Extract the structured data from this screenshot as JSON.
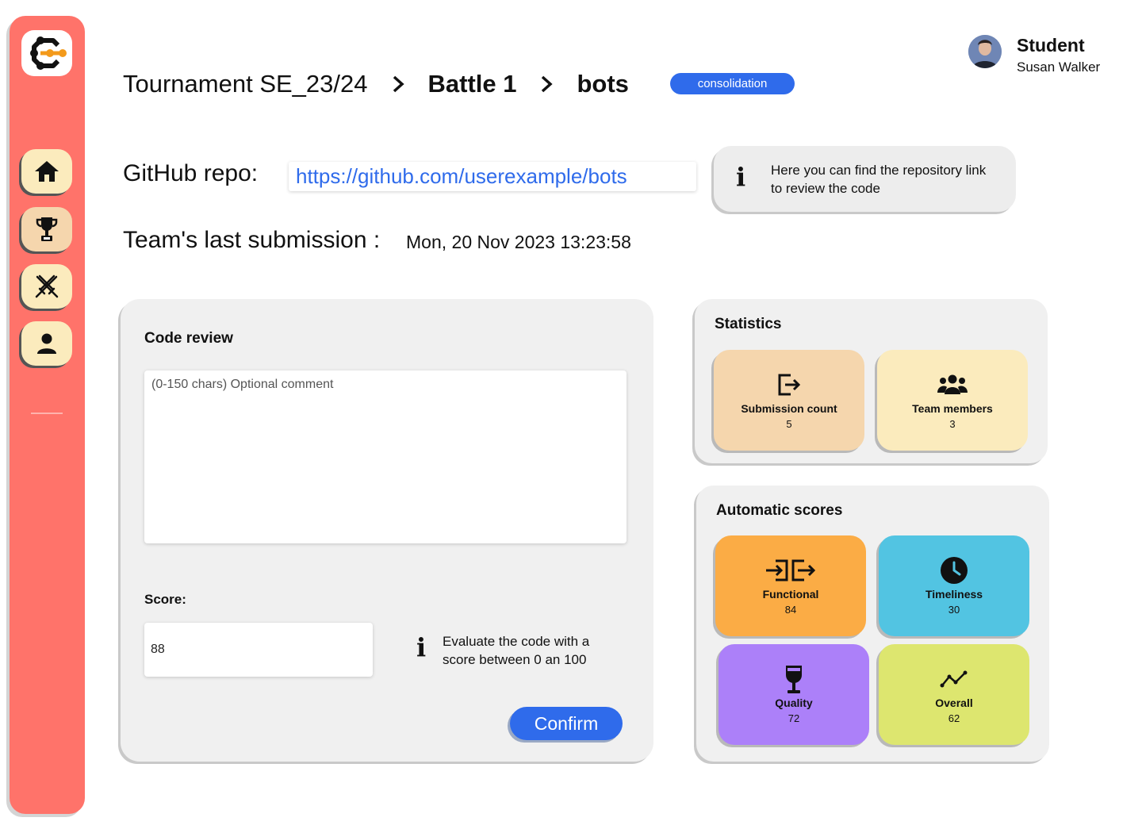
{
  "breadcrumb": {
    "tournament": "Tournament SE_23/24",
    "battle": "Battle 1",
    "page": "bots",
    "status_badge": "consolidation"
  },
  "user": {
    "role": "Student",
    "name": "Susan Walker"
  },
  "repo": {
    "label": "GitHub repo:",
    "url": "https://github.com/userexample/bots",
    "info": "Here you can find the repository link to review the code"
  },
  "submission": {
    "label": "Team's last submission :",
    "value": "Mon, 20 Nov 2023 13:23:58"
  },
  "review": {
    "title": "Code review",
    "comment_placeholder": "(0-150 chars) Optional comment",
    "score_label": "Score:",
    "score_value": "88",
    "score_info": "Evaluate the code with a score between 0 an 100",
    "confirm_label": "Confirm"
  },
  "statistics": {
    "title": "Statistics",
    "submission_count": {
      "label": "Submission count",
      "value": "5"
    },
    "team_members": {
      "label": "Team members",
      "value": "3"
    }
  },
  "automatic_scores": {
    "title": "Automatic scores",
    "functional": {
      "label": "Functional",
      "value": "84"
    },
    "timeliness": {
      "label": "Timeliness",
      "value": "30"
    },
    "quality": {
      "label": "Quality",
      "value": "72"
    },
    "overall": {
      "label": "Overall",
      "value": "62"
    }
  },
  "info_glyph": "i",
  "sidebar_icons": [
    "home-icon",
    "trophy-icon",
    "battle-icon",
    "profile-icon"
  ],
  "colors": {
    "sidebar": "#FF736A",
    "accent": "#2F6BEB",
    "submission_tile": "#F5D6AD",
    "members_tile": "#FBEBBD",
    "functional_tile": "#FBAC45",
    "timeliness_tile": "#52C4E2",
    "quality_tile": "#AC80F9",
    "overall_tile": "#DDE66F"
  }
}
